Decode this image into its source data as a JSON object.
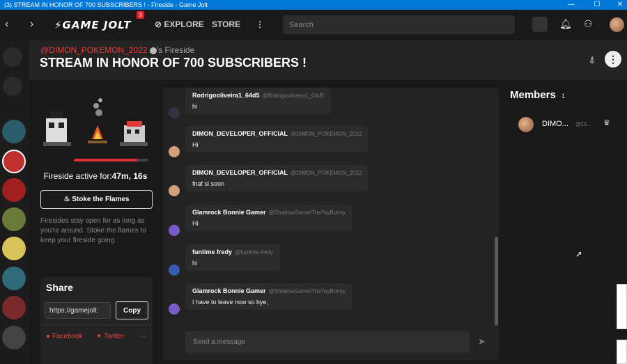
{
  "window": {
    "title": "(3) STREAM IN HONOR OF 700 SUBSCRIBERS ! - Fireside - Game Jolt",
    "minimize": "—",
    "maximize": "☐",
    "close": "✕"
  },
  "topbar": {
    "back": "‹",
    "forward": "›",
    "logo": "GAME JOLT",
    "notification_badge": "3",
    "explore": "EXPLORE",
    "store": "STORE",
    "more": "⋮",
    "search_placeholder": "Search",
    "icons": [
      "quest-icon",
      "bell-icon",
      "friends-icon",
      "avatar"
    ]
  },
  "header": {
    "owner": "@DIMON_POKEMON_2022",
    "owner_suffix": "'s Fireside",
    "title": "STREAM IN HONOR OF 700 SUBSCRIBERS !"
  },
  "fireside": {
    "progress": 0.85,
    "active_label": "Fireside active for:",
    "active_time": "47m, 16s",
    "stoke_button": "Stoke the Flames",
    "note": "Firesides stay open for as long as you're around. Stoke the flames to keep your fireside going."
  },
  "share": {
    "title": "Share",
    "url": "https://gamejolt.",
    "copy": "Copy",
    "facebook": "Facebook",
    "twitter": "Twitter",
    "more": "···"
  },
  "chat": {
    "messages": [
      {
        "name": "Rodrigooliveira1_64d5",
        "handle": "@Rodrigooliveira1_64d5",
        "text": "hi"
      },
      {
        "name": "DIMON_DEVELOPER_OFFICIAL",
        "handle": "@DIMON_POKEMON_2022",
        "text": "Hi"
      },
      {
        "name": "DIMON_DEVELOPER_OFFICIAL",
        "handle": "@DIMON_POKEMON_2022",
        "text": "fnaf sl soon"
      },
      {
        "name": "Glamrock Bonnie Gamer",
        "handle": "@ShadowGamerTheToyBunny",
        "text": "Hi"
      },
      {
        "name": "funtime fredy",
        "handle": "@funtime-fredy",
        "text": "hi"
      },
      {
        "name": "Glamrock Bonnie Gamer",
        "handle": "@ShadowGamerTheToyBunny",
        "text": "I have to leave now so bye,"
      }
    ],
    "compose_placeholder": "Send a message"
  },
  "members": {
    "title": "Members",
    "count": "1",
    "list": [
      {
        "name": "DIMO...",
        "handle": "@DI..."
      }
    ]
  },
  "colors": {
    "accent": "#e83b3b",
    "background": "#191919",
    "panel": "#232323"
  }
}
